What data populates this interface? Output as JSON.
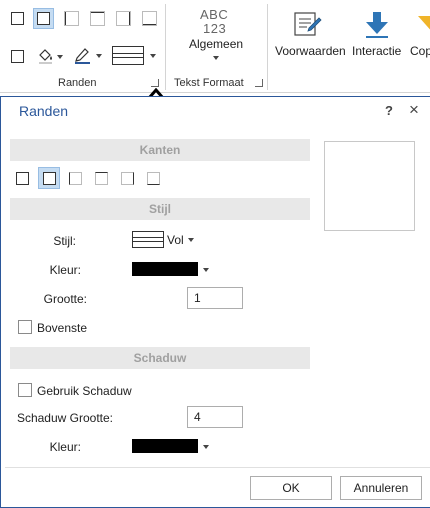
{
  "ribbon": {
    "groups": {
      "randen": "Randen",
      "tekst_formaat": "Tekst Formaat"
    },
    "text_format": {
      "abc": "ABC",
      "num": "123",
      "label": "Algemeen"
    },
    "buttons": {
      "voorwaarden": "Voorwaarden",
      "interactie": "Interactie",
      "copy": "Cop"
    },
    "colors": {
      "accent": "#2b579a",
      "selected_bg": "#c5dcf2",
      "interactie_arrow": "#2e75b6",
      "copy_icon": "#f0b429"
    }
  },
  "dialog": {
    "title": "Randen",
    "help": "?",
    "close": "×",
    "sections": {
      "kanten": "Kanten",
      "stijl": "Stijl",
      "schaduw": "Schaduw"
    },
    "stijl": {
      "stijl_label": "Stijl:",
      "stijl_value": "Vol",
      "kleur_label": "Kleur:",
      "kleur_value": "#000000",
      "grootte_label": "Grootte:",
      "grootte_value": "1",
      "bovenste_label": "Bovenste"
    },
    "schaduw": {
      "gebruik_label": "Gebruik Schaduw",
      "grootte_label": "Schaduw Grootte:",
      "grootte_value": "4",
      "kleur_label": "Kleur:",
      "kleur_value": "#000000"
    },
    "ok": "OK",
    "cancel": "Annuleren"
  }
}
